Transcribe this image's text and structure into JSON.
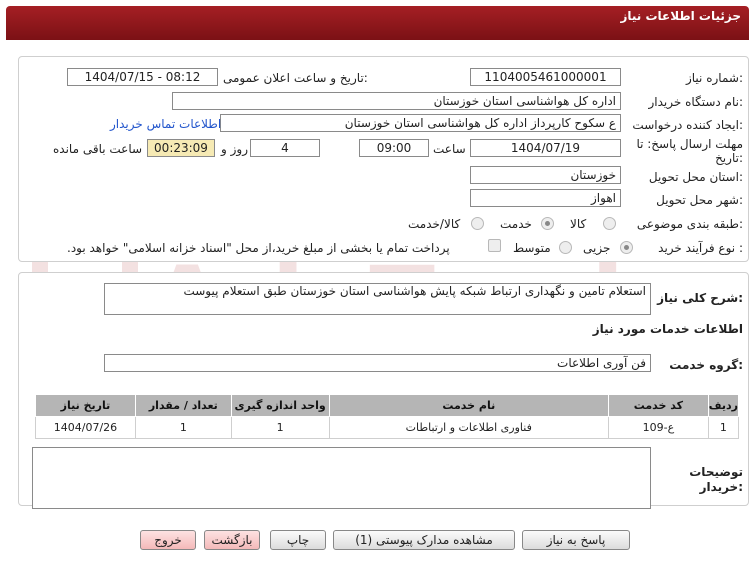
{
  "header": {
    "title": "جزئیات اطلاعات نیاز"
  },
  "form": {
    "need_number_label": "شماره نیاز:",
    "need_number": "1104005461000001",
    "announce_label": "تاریخ و ساعت اعلان عمومی:",
    "announce_value": "1404/07/15 - 08:12",
    "buyer_org_label": "نام دستگاه خریدار:",
    "buyer_org": "اداره کل هواشناسی استان خوزستان",
    "creator_label": "ایجاد کننده درخواست:",
    "creator": "ع سکوح کارپرداز اداره کل هواشناسی استان خوزستان",
    "contact_link": "اطلاعات تماس خریدار",
    "deadline_label_1": "مهلت ارسال پاسخ: تا",
    "deadline_label_2": "تاریخ:",
    "deadline_date": "1404/07/19",
    "time_label": "ساعت",
    "deadline_time": "09:00",
    "days_value": "4",
    "days_label": "روز و",
    "remaining_time": "00:23:09",
    "remaining_label": "ساعت باقی مانده",
    "province_label": "استان محل تحویل:",
    "province": "خوزستان",
    "city_label": "شهر محل تحویل:",
    "city": "اهواز",
    "category_label": "طبقه بندی موضوعی:",
    "category_options": [
      "کالا",
      "خدمت",
      "کالا/خدمت"
    ],
    "category_selected": "خدمت",
    "process_label": "نوع فرآیند خرید :",
    "process_options": [
      "جزیی",
      "متوسط"
    ],
    "payment_note": "پرداخت تمام یا بخشی از مبلغ خرید،از محل \"اسناد خزانه اسلامی\" خواهد بود."
  },
  "description": {
    "label": "شرح کلی نیاز:",
    "text": "استعلام تامین و نگهداری ارتباط شبکه پایش هواشناسی استان خوزستان طبق استعلام پیوست"
  },
  "services": {
    "section_title": "اطلاعات خدمات مورد نیاز",
    "group_label": "گروه خدمت:",
    "group_value": "فن آوری اطلاعات",
    "table": {
      "headers": [
        "ردیف",
        "کد خدمت",
        "نام خدمت",
        "واحد اندازه گیری",
        "تعداد / مقدار",
        "تاریخ نیاز"
      ],
      "rows": [
        [
          "1",
          "ع-109",
          "فناوری اطلاعات و ارتباطات",
          "1",
          "1",
          "1404/07/26"
        ]
      ]
    }
  },
  "buyer_notes": {
    "label_1": "توضیحات",
    "label_2": "خریدار:",
    "text": ""
  },
  "buttons": {
    "reply": "پاسخ به نیاز",
    "view_docs": "مشاهده مدارک پیوستی (1)",
    "print": "چاپ",
    "back": "بازگشت",
    "exit": "خروج"
  },
  "watermark": {
    "text": "AriaTender.net"
  }
}
